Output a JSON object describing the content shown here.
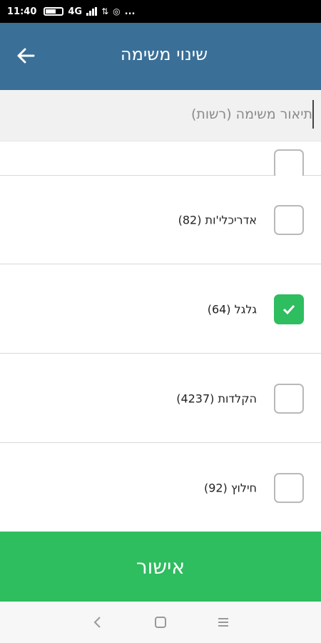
{
  "status_bar": {
    "time": "11:40",
    "network": "4G",
    "more": "..."
  },
  "header": {
    "title": "שינוי משימה"
  },
  "description": {
    "placeholder": "תיאור משימה (רשות)",
    "value": ""
  },
  "categories": [
    {
      "label": "",
      "checked": false
    },
    {
      "label": "אדריכלי'ות (82)",
      "checked": false
    },
    {
      "label": "גלגל (64)",
      "checked": true
    },
    {
      "label": "הקלדות (4237)",
      "checked": false
    },
    {
      "label": "חילוץ (92)",
      "checked": false
    }
  ],
  "confirm": {
    "label": "אישור"
  },
  "colors": {
    "app_bar": "#3a6f97",
    "accent_green": "#2ebd5f"
  }
}
